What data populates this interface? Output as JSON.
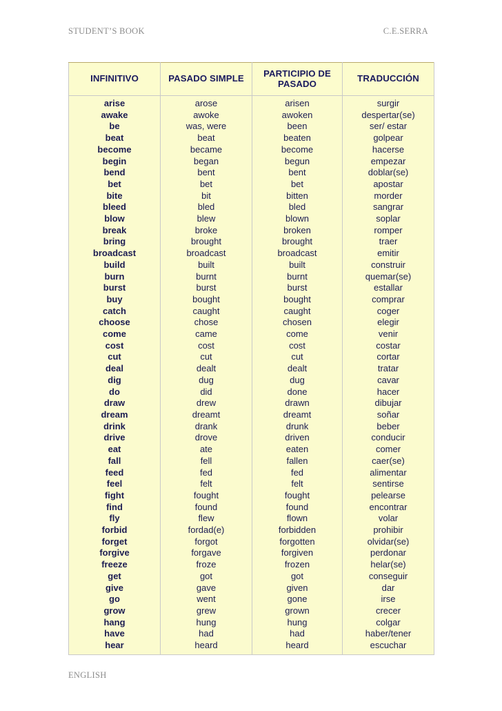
{
  "running_head": {
    "left": "STUDENT’S BOOK",
    "right": "C.E.SERRA"
  },
  "table": {
    "headers": [
      "INFINITIVO",
      "PASADO SIMPLE",
      "PARTICIPIO DE PASADO",
      "TRADUCCIÓN"
    ],
    "rows": [
      [
        "arise",
        "arose",
        "arisen",
        "surgir"
      ],
      [
        "awake",
        "awoke",
        "awoken",
        "despertar(se)"
      ],
      [
        "be",
        "was, were",
        "been",
        "ser/ estar"
      ],
      [
        "beat",
        "beat",
        "beaten",
        "golpear"
      ],
      [
        "become",
        "became",
        "become",
        "hacerse"
      ],
      [
        "begin",
        "began",
        "begun",
        "empezar"
      ],
      [
        "bend",
        "bent",
        "bent",
        "doblar(se)"
      ],
      [
        "bet",
        "bet",
        "bet",
        "apostar"
      ],
      [
        "bite",
        "bit",
        "bitten",
        "morder"
      ],
      [
        "bleed",
        "bled",
        "bled",
        "sangrar"
      ],
      [
        "blow",
        "blew",
        "blown",
        "soplar"
      ],
      [
        "break",
        "broke",
        "broken",
        "romper"
      ],
      [
        "bring",
        "brought",
        "brought",
        "traer"
      ],
      [
        "broadcast",
        "broadcast",
        "broadcast",
        "emitir"
      ],
      [
        "build",
        "built",
        "built",
        "construir"
      ],
      [
        "burn",
        "burnt",
        "burnt",
        "quemar(se)"
      ],
      [
        "burst",
        "burst",
        "burst",
        "estallar"
      ],
      [
        "buy",
        "bought",
        "bought",
        "comprar"
      ],
      [
        "catch",
        "caught",
        "caught",
        "coger"
      ],
      [
        "choose",
        "chose",
        "chosen",
        "elegir"
      ],
      [
        "come",
        "came",
        "come",
        "venir"
      ],
      [
        "cost",
        "cost",
        "cost",
        "costar"
      ],
      [
        "cut",
        "cut",
        "cut",
        "cortar"
      ],
      [
        "deal",
        "dealt",
        "dealt",
        "tratar"
      ],
      [
        "dig",
        "dug",
        "dug",
        "cavar"
      ],
      [
        "do",
        "did",
        "done",
        "hacer"
      ],
      [
        "draw",
        "drew",
        "drawn",
        "dibujar"
      ],
      [
        "dream",
        "dreamt",
        "dreamt",
        "soñar"
      ],
      [
        "drink",
        "drank",
        "drunk",
        "beber"
      ],
      [
        "drive",
        "drove",
        "driven",
        "conducir"
      ],
      [
        "eat",
        "ate",
        "eaten",
        "comer"
      ],
      [
        "fall",
        "fell",
        "fallen",
        "caer(se)"
      ],
      [
        "feed",
        "fed",
        "fed",
        "alimentar"
      ],
      [
        "feel",
        "felt",
        "felt",
        "sentirse"
      ],
      [
        "fight",
        "fought",
        "fought",
        "pelearse"
      ],
      [
        "find",
        "found",
        "found",
        "encontrar"
      ],
      [
        "fly",
        "flew",
        "flown",
        "volar"
      ],
      [
        "forbid",
        "fordad(e)",
        "forbidden",
        "prohibir"
      ],
      [
        "forget",
        "forgot",
        "forgotten",
        "olvidar(se)"
      ],
      [
        "forgive",
        "forgave",
        "forgiven",
        "perdonar"
      ],
      [
        "freeze",
        "froze",
        "frozen",
        "helar(se)"
      ],
      [
        "get",
        "got",
        "got",
        "conseguir"
      ],
      [
        "give",
        "gave",
        "given",
        "dar"
      ],
      [
        "go",
        "went",
        "gone",
        "irse"
      ],
      [
        "grow",
        "grew",
        "grown",
        "crecer"
      ],
      [
        "hang",
        "hung",
        "hung",
        "colgar"
      ],
      [
        "have",
        "had",
        "had",
        "haber/tener"
      ],
      [
        "hear",
        "heard",
        "heard",
        "escuchar"
      ]
    ]
  },
  "footer": {
    "label": "ENGLISH"
  },
  "colors": {
    "table_cell_background": "#fbfbce",
    "table_header_background": "#fcfccd",
    "text_navy": "#1c1c52",
    "header_navy": "#1a1a5e",
    "running_head_gray": "#8c8c8c",
    "border_gray": "#c9c9c9",
    "border_gold": "#b9a96a",
    "page_background": "#ffffff"
  }
}
